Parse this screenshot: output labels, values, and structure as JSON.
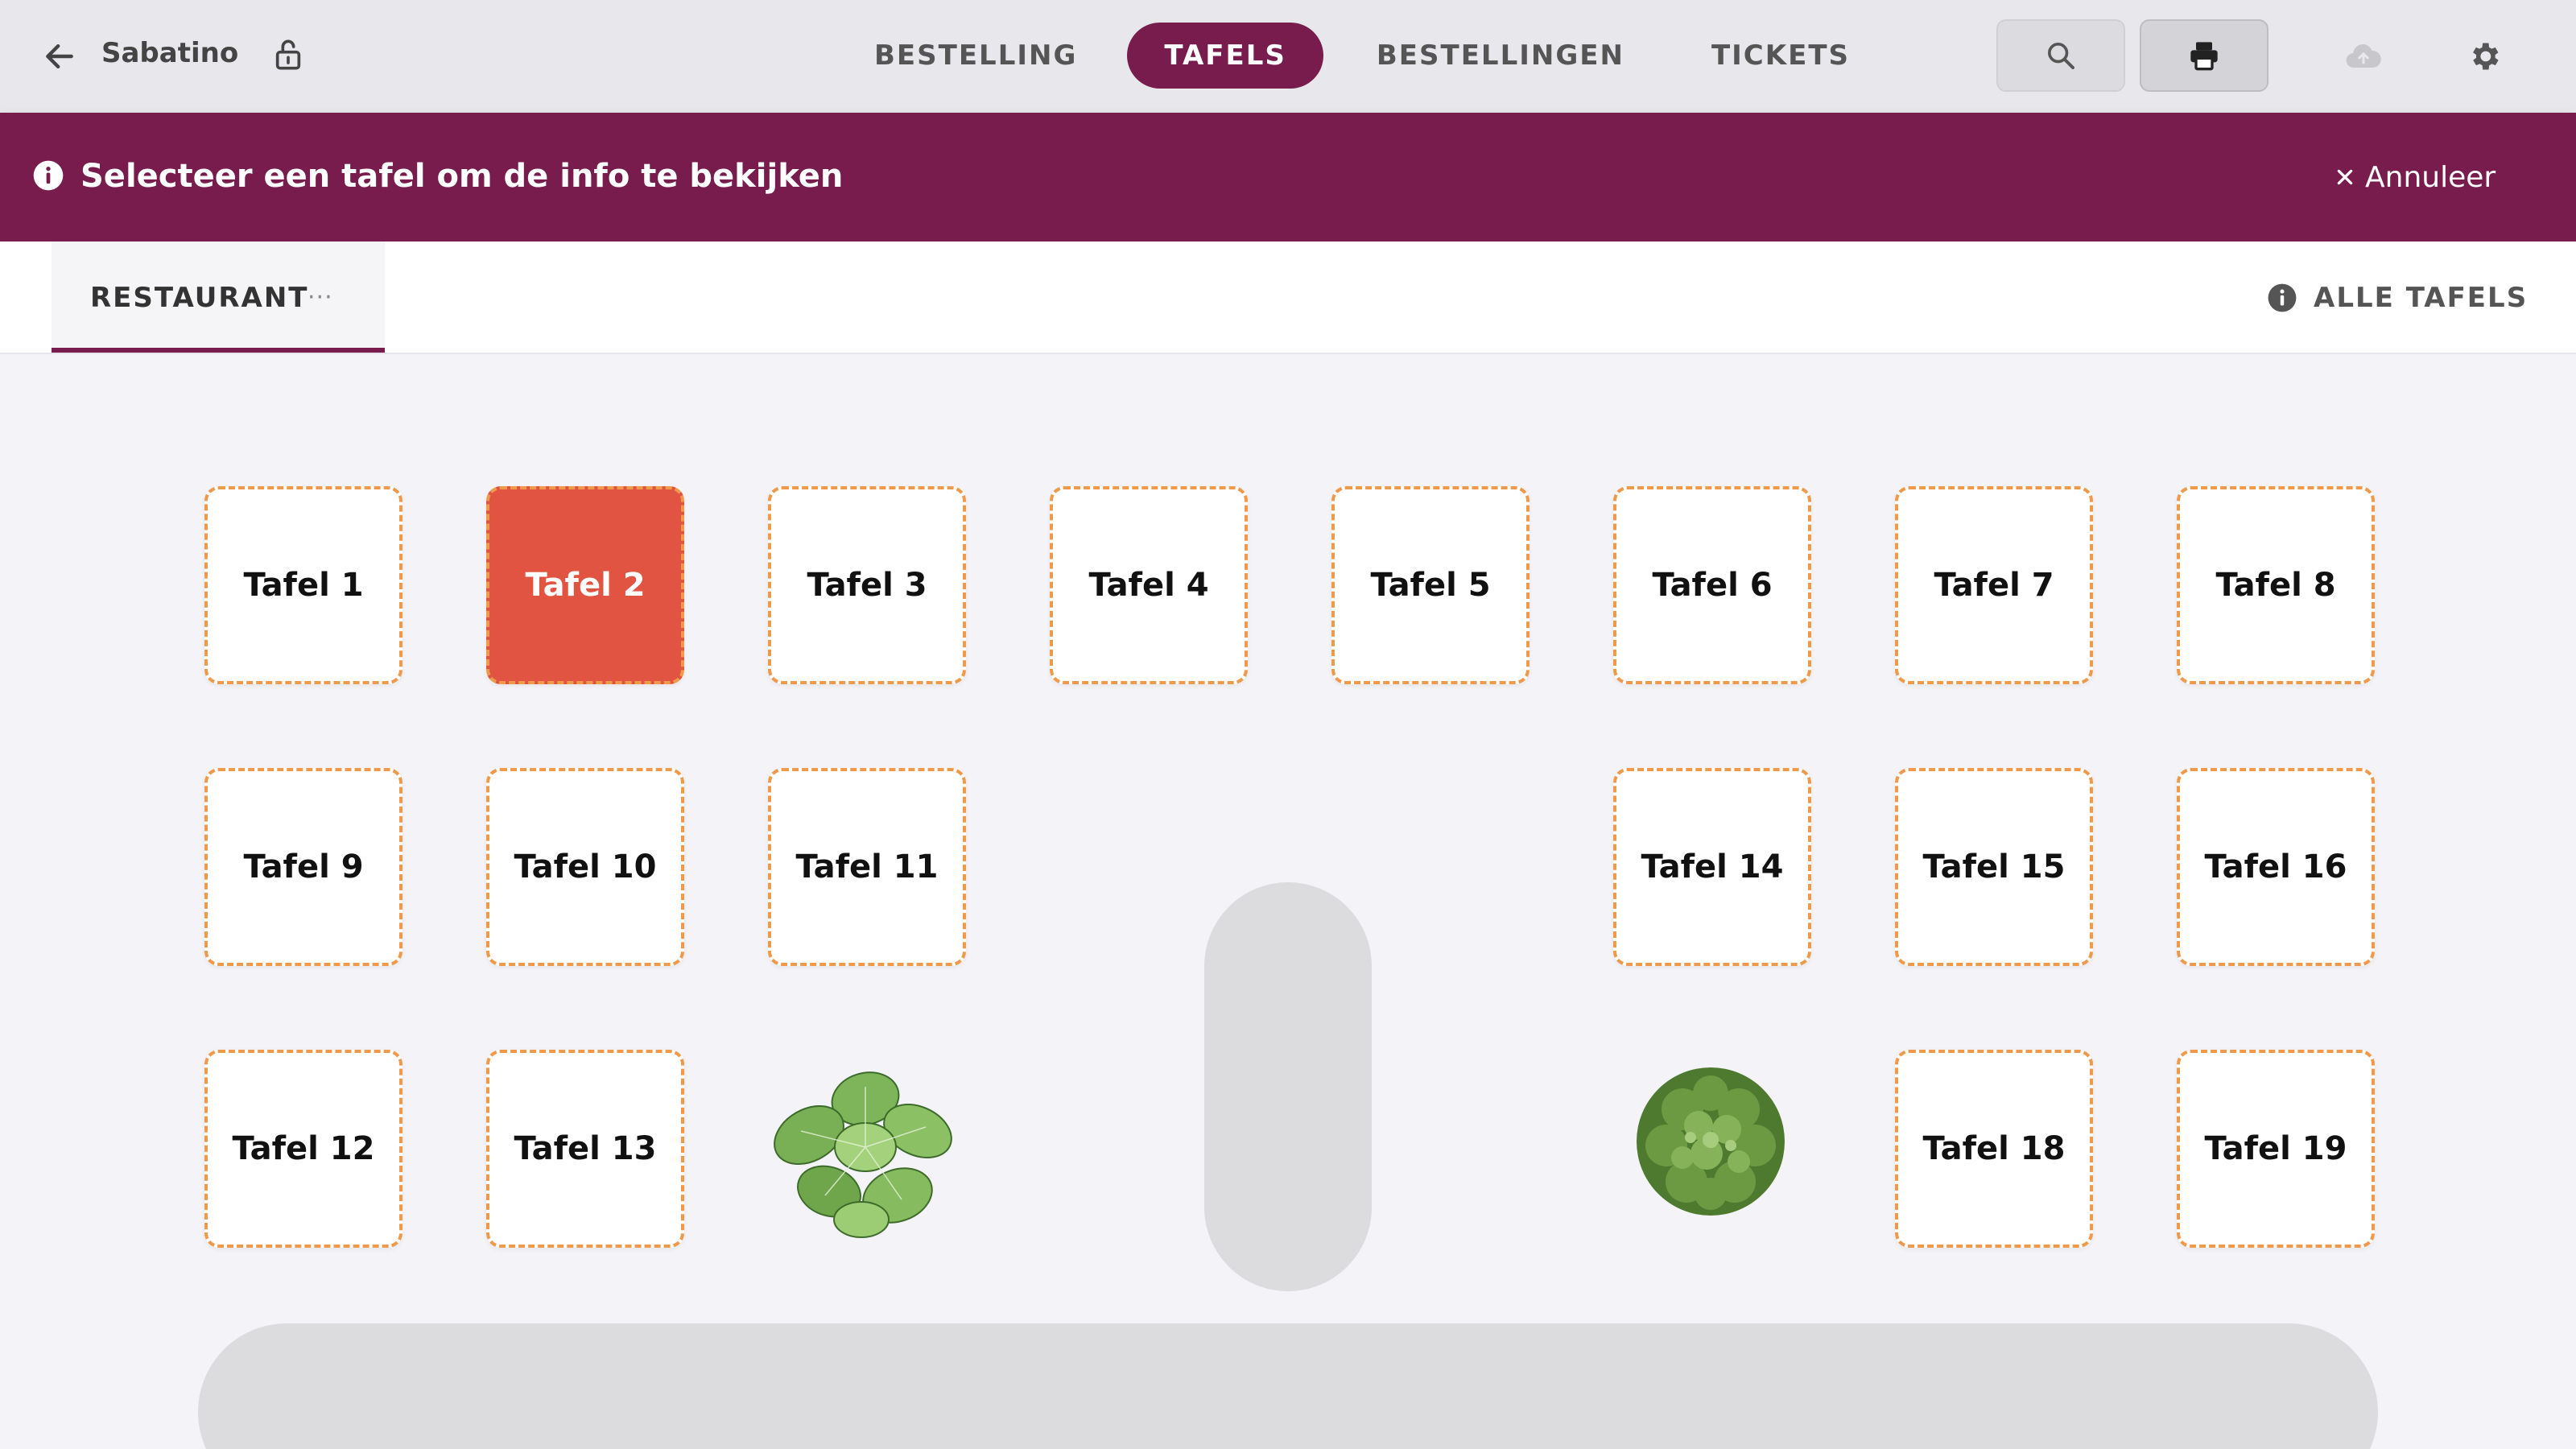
{
  "header": {
    "app_name": "Sabatino",
    "tabs": [
      {
        "label": "BESTELLING",
        "active": false
      },
      {
        "label": "TAFELS",
        "active": true
      },
      {
        "label": "BESTELLINGEN",
        "active": false
      },
      {
        "label": "TICKETS",
        "active": false
      }
    ],
    "icons": [
      "back-arrow-icon",
      "lock-icon",
      "search-icon",
      "printer-icon",
      "cloud-icon",
      "gear-icon"
    ]
  },
  "banner": {
    "message": "Selecteer een tafel om de info te bekijken",
    "cancel_label": "Annuleer",
    "color": "#781c4e"
  },
  "subheader": {
    "room_label": "RESTAURANT",
    "more_label": "···",
    "all_tables_label": "ALLE TAFELS"
  },
  "floor": {
    "tables": [
      {
        "label": "Tafel 1",
        "selected": false
      },
      {
        "label": "Tafel 2",
        "selected": true
      },
      {
        "label": "Tafel 3",
        "selected": false
      },
      {
        "label": "Tafel 4",
        "selected": false
      },
      {
        "label": "Tafel 5",
        "selected": false
      },
      {
        "label": "Tafel 6",
        "selected": false
      },
      {
        "label": "Tafel 7",
        "selected": false
      },
      {
        "label": "Tafel 8",
        "selected": false
      },
      {
        "label": "Tafel 9",
        "selected": false
      },
      {
        "label": "Tafel 10",
        "selected": false
      },
      {
        "label": "Tafel 11",
        "selected": false
      },
      {
        "label": "Tafel 14",
        "selected": false
      },
      {
        "label": "Tafel 15",
        "selected": false
      },
      {
        "label": "Tafel 16",
        "selected": false
      },
      {
        "label": "Tafel 12",
        "selected": false
      },
      {
        "label": "Tafel 13",
        "selected": false
      },
      {
        "label": "Tafel 18",
        "selected": false
      },
      {
        "label": "Tafel 19",
        "selected": false
      }
    ],
    "colors": {
      "table_border": "#ef9a4a",
      "selected_table": "#e05441"
    }
  }
}
